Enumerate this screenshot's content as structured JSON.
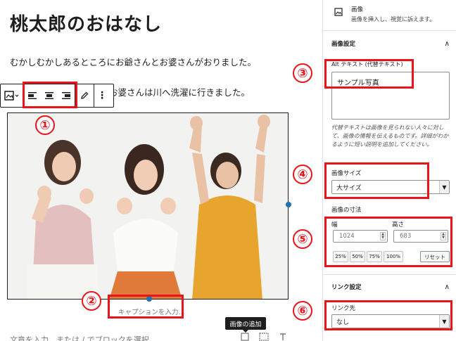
{
  "editor": {
    "title": "桃太郎のおはなし",
    "paragraph1": "むかしむかしあるところにお爺さんとお婆さんがおりました。",
    "paragraph2": "お婆さんは川へ洗濯に行きました。",
    "image_alt": "サンプル写真",
    "caption_placeholder": "キャプションを入力...",
    "block_placeholder": "文章を入力、または / でブロックを選択",
    "tooltip": "画像の追加",
    "toolbar": {
      "icons": [
        "image-icon",
        "chevron-down-icon",
        "align-left-icon",
        "align-center-icon",
        "align-right-icon",
        "pencil-icon",
        "more-vertical-icon"
      ]
    }
  },
  "sidebar": {
    "block_name": "画像",
    "block_description": "画像を挿入し、視覚に訴えます。",
    "image_settings": {
      "title": "画像設定",
      "alt_label": "Alt テキスト (代替テキスト)",
      "alt_value": "サンプル写真",
      "alt_help": "代替テキストは画像を見られない人々に対して、画像の情報を伝えるものです。詳細がわかるように短い説明を追加してください。",
      "size_label": "画像サイズ",
      "size_value": "大サイズ",
      "dimensions_label": "画像の寸法",
      "width_label": "幅",
      "width_value": "1024",
      "height_label": "高さ",
      "height_value": "683",
      "percent_buttons": [
        "25%",
        "50%",
        "75%",
        "100%"
      ],
      "reset_label": "リセット"
    },
    "link_settings": {
      "title": "リンク設定",
      "link_label": "リンク先",
      "link_value": "なし"
    }
  },
  "annotations": [
    "①",
    "②",
    "③",
    "④",
    "⑤",
    "⑥"
  ],
  "colors": {
    "annotation_red": "#e8141a",
    "handle_blue": "#2271b1",
    "toolbar_border": "#1e1e1e"
  }
}
